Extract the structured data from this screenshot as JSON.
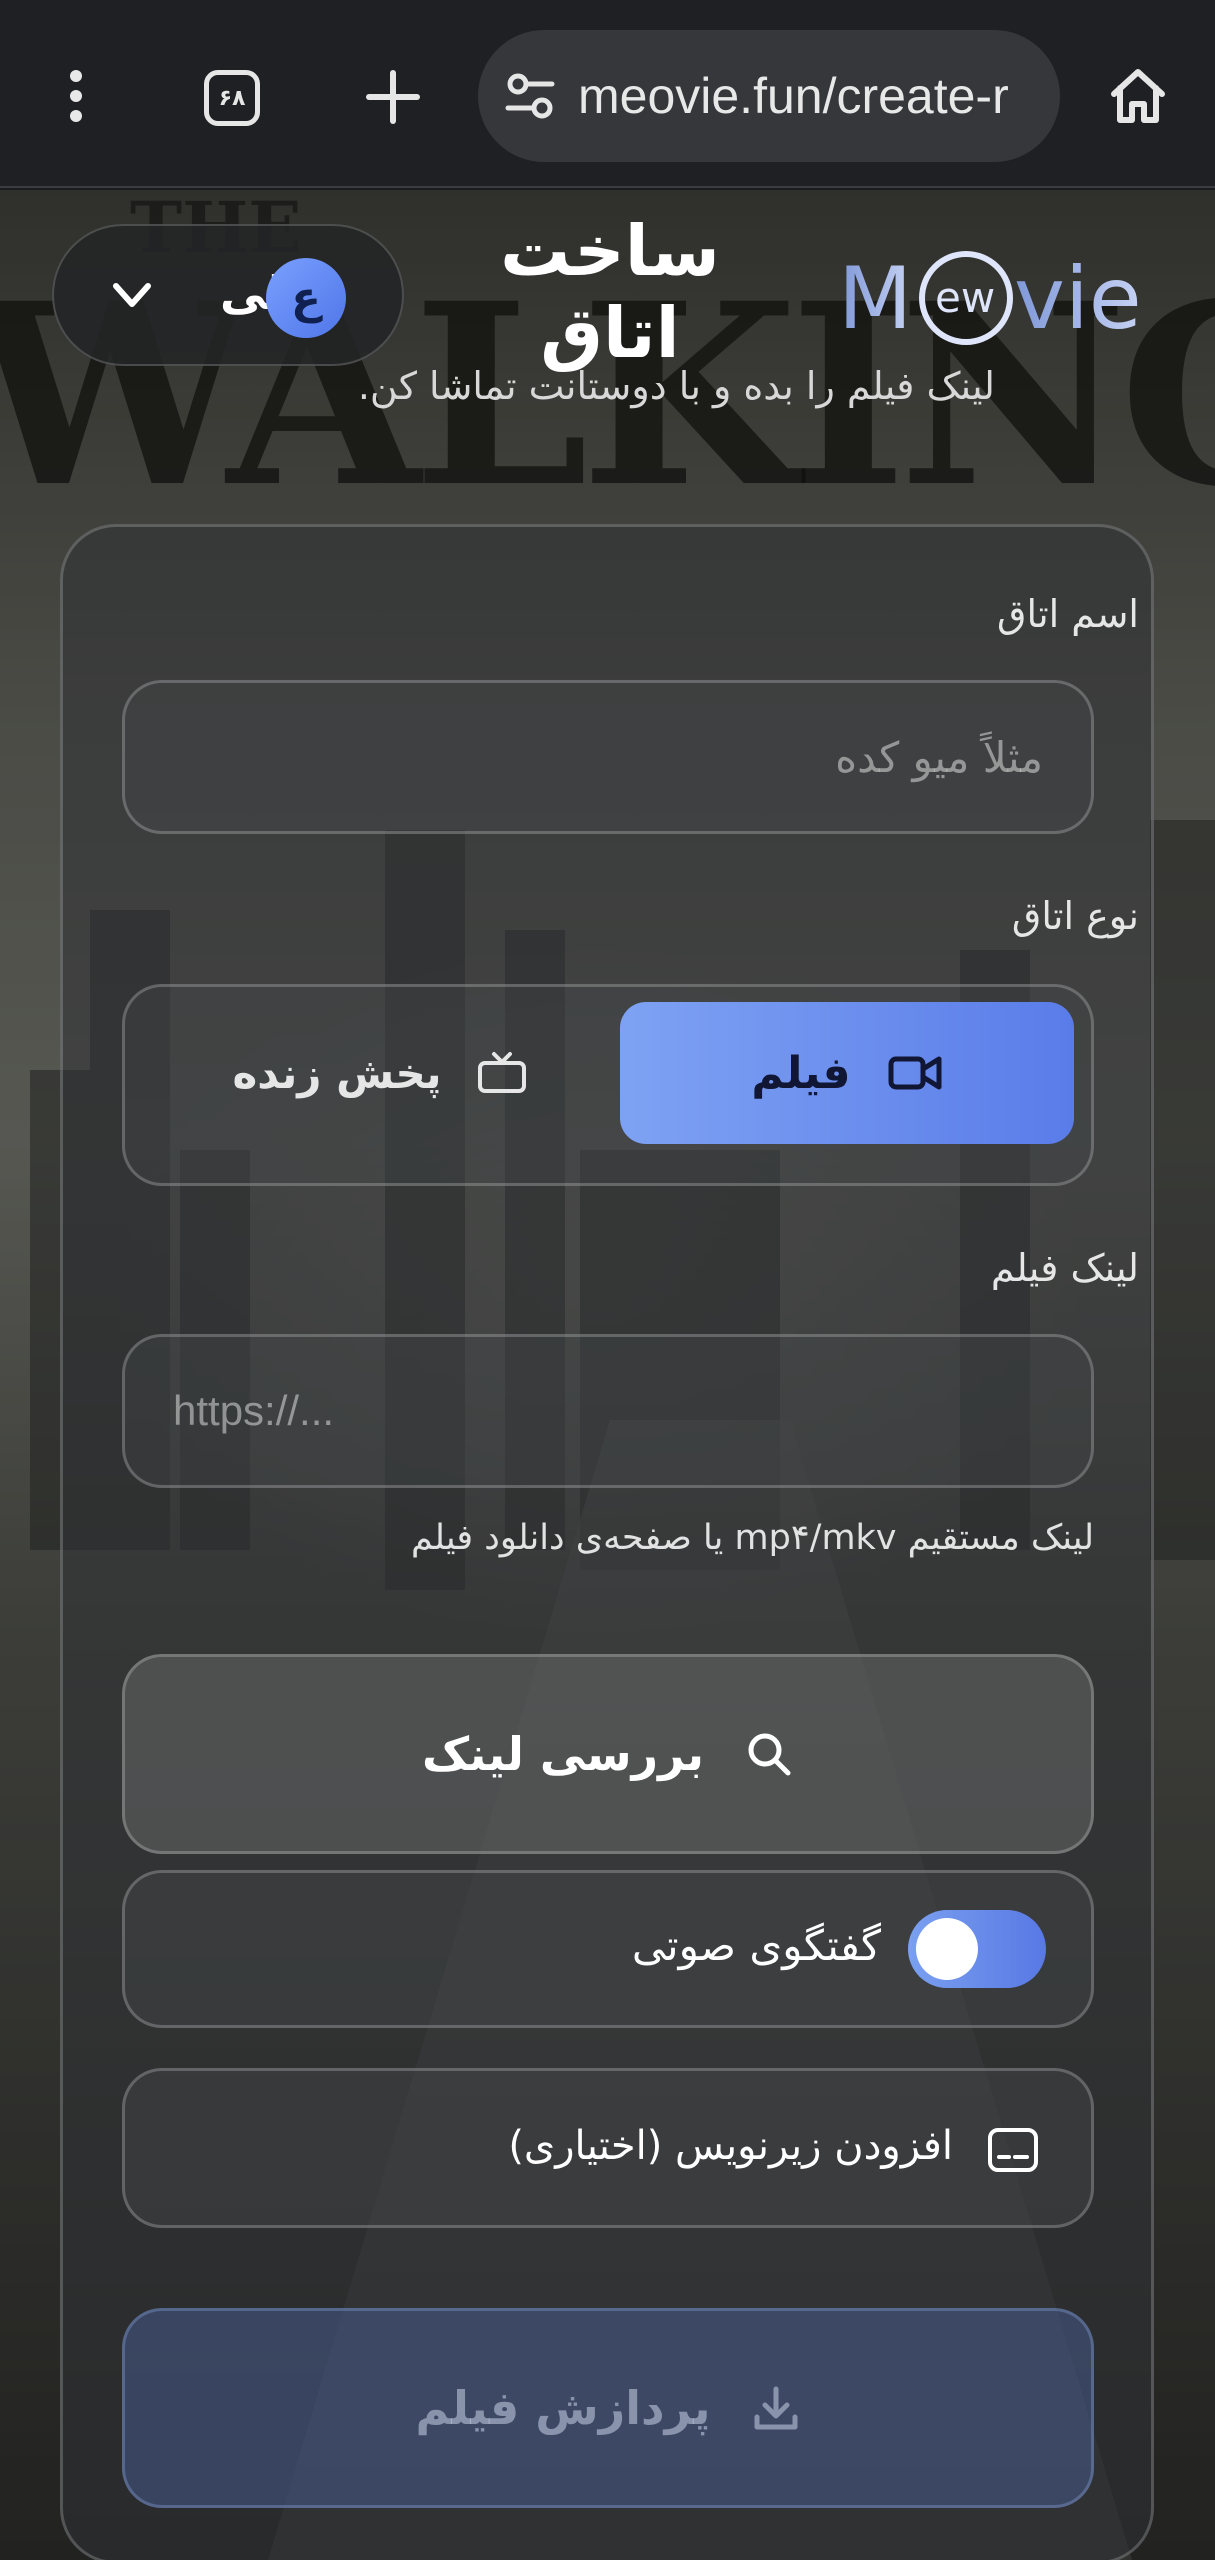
{
  "browser": {
    "tab_count": "۶۸",
    "url": "meovie.fun/create-r",
    "icons": {
      "menu": "more-vertical-icon",
      "tabs": "tab-switcher-icon",
      "new_tab": "plus-icon",
      "site_info": "tune-icon",
      "home": "home-icon"
    }
  },
  "header": {
    "user_name": "علی",
    "avatar_letter": "ع",
    "title": "ساخت اتاق",
    "subtitle": "لینک فیلم را بده و با دوستانت تماشا کن.",
    "logo_text": "MeWovie"
  },
  "background": {
    "title_text": "WALKING DEAD",
    "top_text": "THE"
  },
  "form": {
    "room_name_label": "اسم اتاق",
    "room_name_placeholder": "مثلاً میو کده",
    "room_type_label": "نوع اتاق",
    "room_types": [
      {
        "label": "فیلم",
        "icon": "video-camera-icon",
        "selected": true
      },
      {
        "label": "پخش زنده",
        "icon": "tv-icon",
        "selected": false
      }
    ],
    "movie_link_label": "لینک فیلم",
    "movie_link_placeholder": "https://...",
    "movie_link_hint": "لینک مستقیم mp۴/mkv یا صفحه‌ی دانلود فیلم",
    "check_link_button": "بررسی لینک",
    "voice_chat_label": "گفتگوی صوتی",
    "voice_chat_enabled": true,
    "add_subtitle_label": "افزودن زیرنویس (اختیاری)",
    "process_button": "پردازش فیلم"
  },
  "colors": {
    "accent": "#6a8cec",
    "chrome_bg": "#1f2023",
    "urlbar_bg": "#35373b"
  }
}
